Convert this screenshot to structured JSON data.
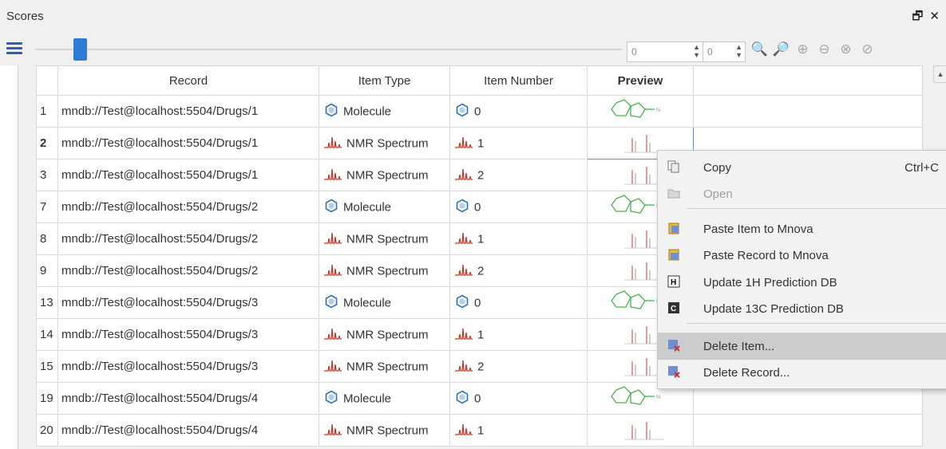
{
  "window": {
    "title": "Scores",
    "restore_icon": "restore-icon",
    "close_icon": "close-icon"
  },
  "toolbar": {
    "spin1_value": "0",
    "spin2_value": "0"
  },
  "table": {
    "headers": [
      "Record",
      "Item Type",
      "Item Number",
      "Preview"
    ],
    "rows": [
      {
        "idx": "1",
        "record": "mndb://Test@localhost:5504/Drugs/1",
        "type": "Molecule",
        "number": "0",
        "kind": "mol"
      },
      {
        "idx": "2",
        "record": "mndb://Test@localhost:5504/Drugs/1",
        "type": "NMR Spectrum",
        "number": "1",
        "kind": "nmr"
      },
      {
        "idx": "3",
        "record": "mndb://Test@localhost:5504/Drugs/1",
        "type": "NMR Spectrum",
        "number": "2",
        "kind": "nmr"
      },
      {
        "idx": "7",
        "record": "mndb://Test@localhost:5504/Drugs/2",
        "type": "Molecule",
        "number": "0",
        "kind": "mol"
      },
      {
        "idx": "8",
        "record": "mndb://Test@localhost:5504/Drugs/2",
        "type": "NMR Spectrum",
        "number": "1",
        "kind": "nmr"
      },
      {
        "idx": "9",
        "record": "mndb://Test@localhost:5504/Drugs/2",
        "type": "NMR Spectrum",
        "number": "2",
        "kind": "nmr"
      },
      {
        "idx": "13",
        "record": "mndb://Test@localhost:5504/Drugs/3",
        "type": "Molecule",
        "number": "0",
        "kind": "mol"
      },
      {
        "idx": "14",
        "record": "mndb://Test@localhost:5504/Drugs/3",
        "type": "NMR Spectrum",
        "number": "1",
        "kind": "nmr"
      },
      {
        "idx": "15",
        "record": "mndb://Test@localhost:5504/Drugs/3",
        "type": "NMR Spectrum",
        "number": "2",
        "kind": "nmr"
      },
      {
        "idx": "19",
        "record": "mndb://Test@localhost:5504/Drugs/4",
        "type": "Molecule",
        "number": "0",
        "kind": "mol"
      },
      {
        "idx": "20",
        "record": "mndb://Test@localhost:5504/Drugs/4",
        "type": "NMR Spectrum",
        "number": "1",
        "kind": "nmr"
      }
    ],
    "selected_idx": "2"
  },
  "context_menu": {
    "items": [
      {
        "label": "Copy",
        "shortcut": "Ctrl+C",
        "icon": "copy-icon",
        "enabled": true
      },
      {
        "label": "Open",
        "icon": "folder-icon",
        "enabled": false
      },
      {
        "label": "Paste Item to Mnova",
        "icon": "paste-item-icon",
        "enabled": true
      },
      {
        "label": "Paste Record to Mnova",
        "icon": "paste-record-icon",
        "enabled": true
      },
      {
        "label": "Update 1H Prediction DB",
        "icon": "h-prediction-icon",
        "enabled": true
      },
      {
        "label": "Update 13C Prediction DB",
        "icon": "c-prediction-icon",
        "enabled": true
      },
      {
        "label": "Delete Item...",
        "icon": "delete-item-icon",
        "enabled": true,
        "highlighted": true
      },
      {
        "label": "Delete Record...",
        "icon": "delete-record-icon",
        "enabled": true
      }
    ]
  },
  "colors": {
    "accent": "#2e7cd6",
    "molecule_icon": "#2a6fb3",
    "nmr_icon": "#c0392b",
    "preview_green": "#4caf50"
  }
}
